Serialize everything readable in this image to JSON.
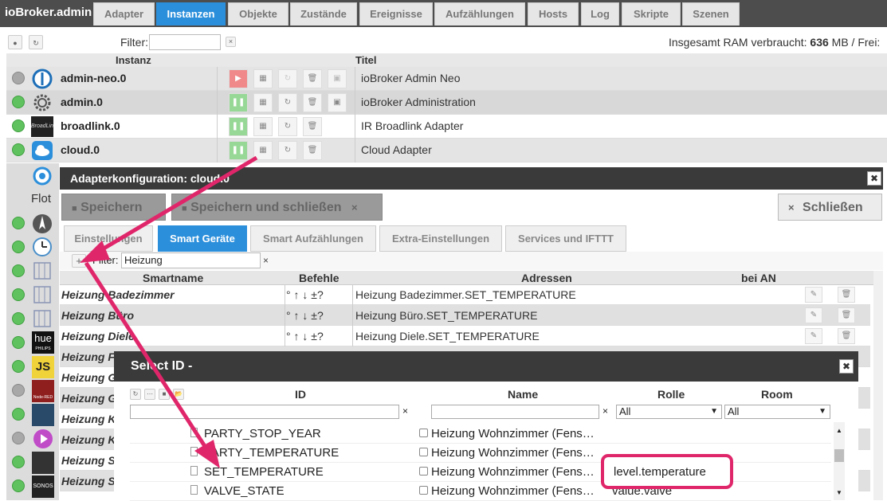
{
  "app": {
    "title": "ioBroker.admin"
  },
  "tabs": [
    "Adapter",
    "Instanzen",
    "Objekte",
    "Zustände",
    "Ereignisse",
    "Aufzählungen",
    "Hosts",
    "Log",
    "Skripte",
    "Szenen"
  ],
  "toolbar": {
    "filter_label": "Filter:",
    "filter_value": "",
    "ram_label": "Insgesamt RAM verbraucht:",
    "ram_value": "636",
    "ram_unit": "MB / Frei:"
  },
  "instances": {
    "headers": {
      "instanz": "Instanz",
      "titel": "Titel"
    },
    "rows": [
      {
        "name": "admin-neo.0",
        "title": "ioBroker Admin Neo",
        "status": "grey"
      },
      {
        "name": "admin.0",
        "title": "ioBroker Administration",
        "status": "green"
      },
      {
        "name": "broadlink.0",
        "title": "IR Broadlink Adapter",
        "status": "green"
      },
      {
        "name": "cloud.0",
        "title": "Cloud Adapter",
        "status": "green"
      }
    ],
    "icon_labels": {
      "flot": "Flot",
      "broadlink": "BroadLink",
      "hue": "hue",
      "philips": "PHILIPS",
      "js": "JS",
      "nodered": "Node-RED",
      "sonos": "SONOS"
    }
  },
  "config_dialog": {
    "title": "Adapterkonfiguration: cloud.0",
    "save": "Speichern",
    "save_close": "Speichern und schließen",
    "close": "Schließen",
    "tabs": [
      "Einstellungen",
      "Smart Geräte",
      "Smart Aufzählungen",
      "Extra-Einstellungen",
      "Services und IFTTT"
    ],
    "filter_label": "Filter:",
    "filter_value": "Heizung",
    "headers": {
      "smartname": "Smartname",
      "befehle": "Befehle",
      "adressen": "Adressen",
      "bei_an": "bei AN"
    },
    "rows": [
      {
        "name": "Heizung Badezimmer",
        "cmd": "° ↑ ↓ ±?",
        "addr": "Heizung Badezimmer.SET_TEMPERATURE"
      },
      {
        "name": "Heizung Büro",
        "cmd": "° ↑ ↓ ±?",
        "addr": "Heizung Büro.SET_TEMPERATURE"
      },
      {
        "name": "Heizung Diele",
        "cmd": "° ↑ ↓ ±?",
        "addr": "Heizung Diele.SET_TEMPERATURE"
      },
      {
        "name": "Heizung F",
        "cmd": "",
        "addr": ""
      },
      {
        "name": "Heizung G",
        "cmd": "",
        "addr": ""
      },
      {
        "name": "Heizung G",
        "cmd": "",
        "addr": ""
      },
      {
        "name": "Heizung K",
        "cmd": "",
        "addr": ""
      },
      {
        "name": "Heizung K",
        "cmd": "",
        "addr": ""
      },
      {
        "name": "Heizung S",
        "cmd": "",
        "addr": ""
      },
      {
        "name": "Heizung S",
        "cmd": "",
        "addr": ""
      }
    ]
  },
  "select_dialog": {
    "title": "Select ID -",
    "headers": {
      "id": "ID",
      "name": "Name",
      "role": "Rolle",
      "room": "Room"
    },
    "role_filter": "All",
    "room_filter": "All",
    "rows": [
      {
        "id": "PARTY_STOP_YEAR",
        "name": "Heizung Wohnzimmer (Fens…",
        "role": ""
      },
      {
        "id": "PARTY_TEMPERATURE",
        "name": "Heizung Wohnzimmer (Fens…",
        "role": ""
      },
      {
        "id": "SET_TEMPERATURE",
        "name": "Heizung Wohnzimmer (Fens…",
        "role": "level.temperature"
      },
      {
        "id": "VALVE_STATE",
        "name": "Heizung Wohnzimmer (Fens…",
        "role": "value.valve"
      }
    ]
  },
  "colors": {
    "accent": "#2c8fdb",
    "highlight": "#e0266a",
    "running": "#5fc25f"
  }
}
